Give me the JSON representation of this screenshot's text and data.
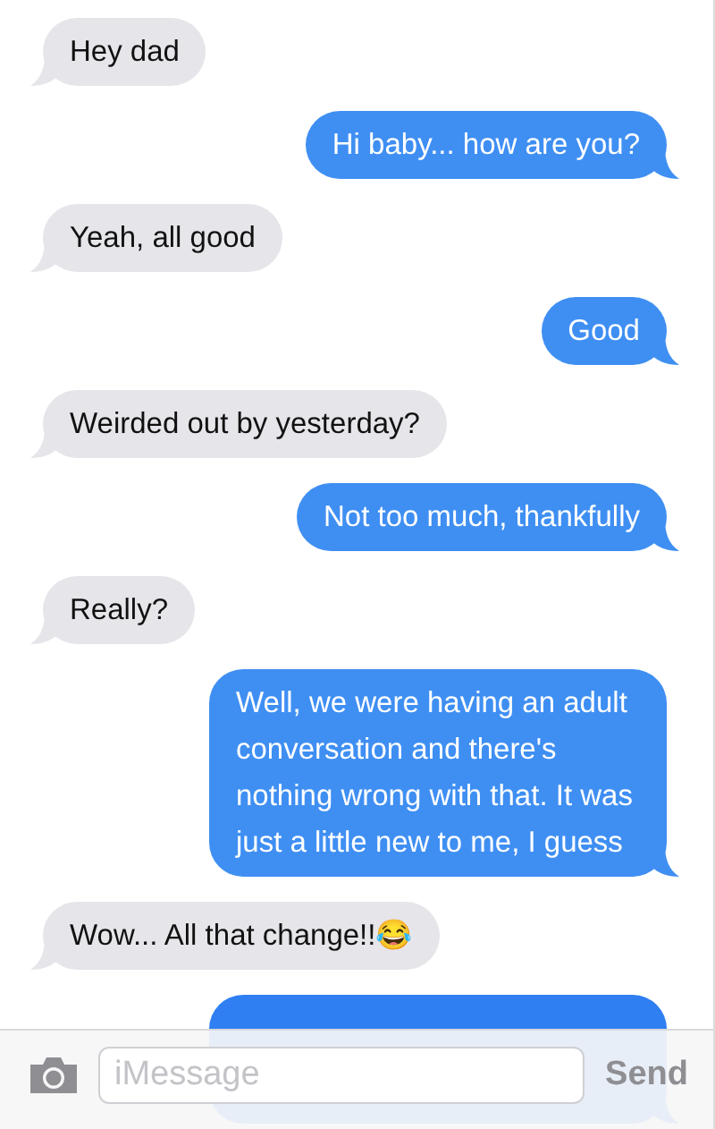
{
  "messages": [
    {
      "kind": "incoming",
      "text": "Hey dad"
    },
    {
      "kind": "outgoing",
      "text": "Hi baby... how are you?"
    },
    {
      "kind": "incoming",
      "text": "Yeah, all good"
    },
    {
      "kind": "outgoing",
      "text": "Good"
    },
    {
      "kind": "incoming",
      "text": "Weirded out by yesterday?"
    },
    {
      "kind": "outgoing",
      "text": "Not too much, thankfully"
    },
    {
      "kind": "incoming",
      "text": "Really?"
    },
    {
      "kind": "outgoing",
      "text": "Well, we were having an adult conversation and there's nothing wrong with that. It was just a little new to me, I guess"
    },
    {
      "kind": "incoming",
      "text": "Wow... All that change!!😂"
    },
    {
      "kind": "outgoing"
    }
  ],
  "composer": {
    "placeholder": "iMessage",
    "send": "Send"
  }
}
